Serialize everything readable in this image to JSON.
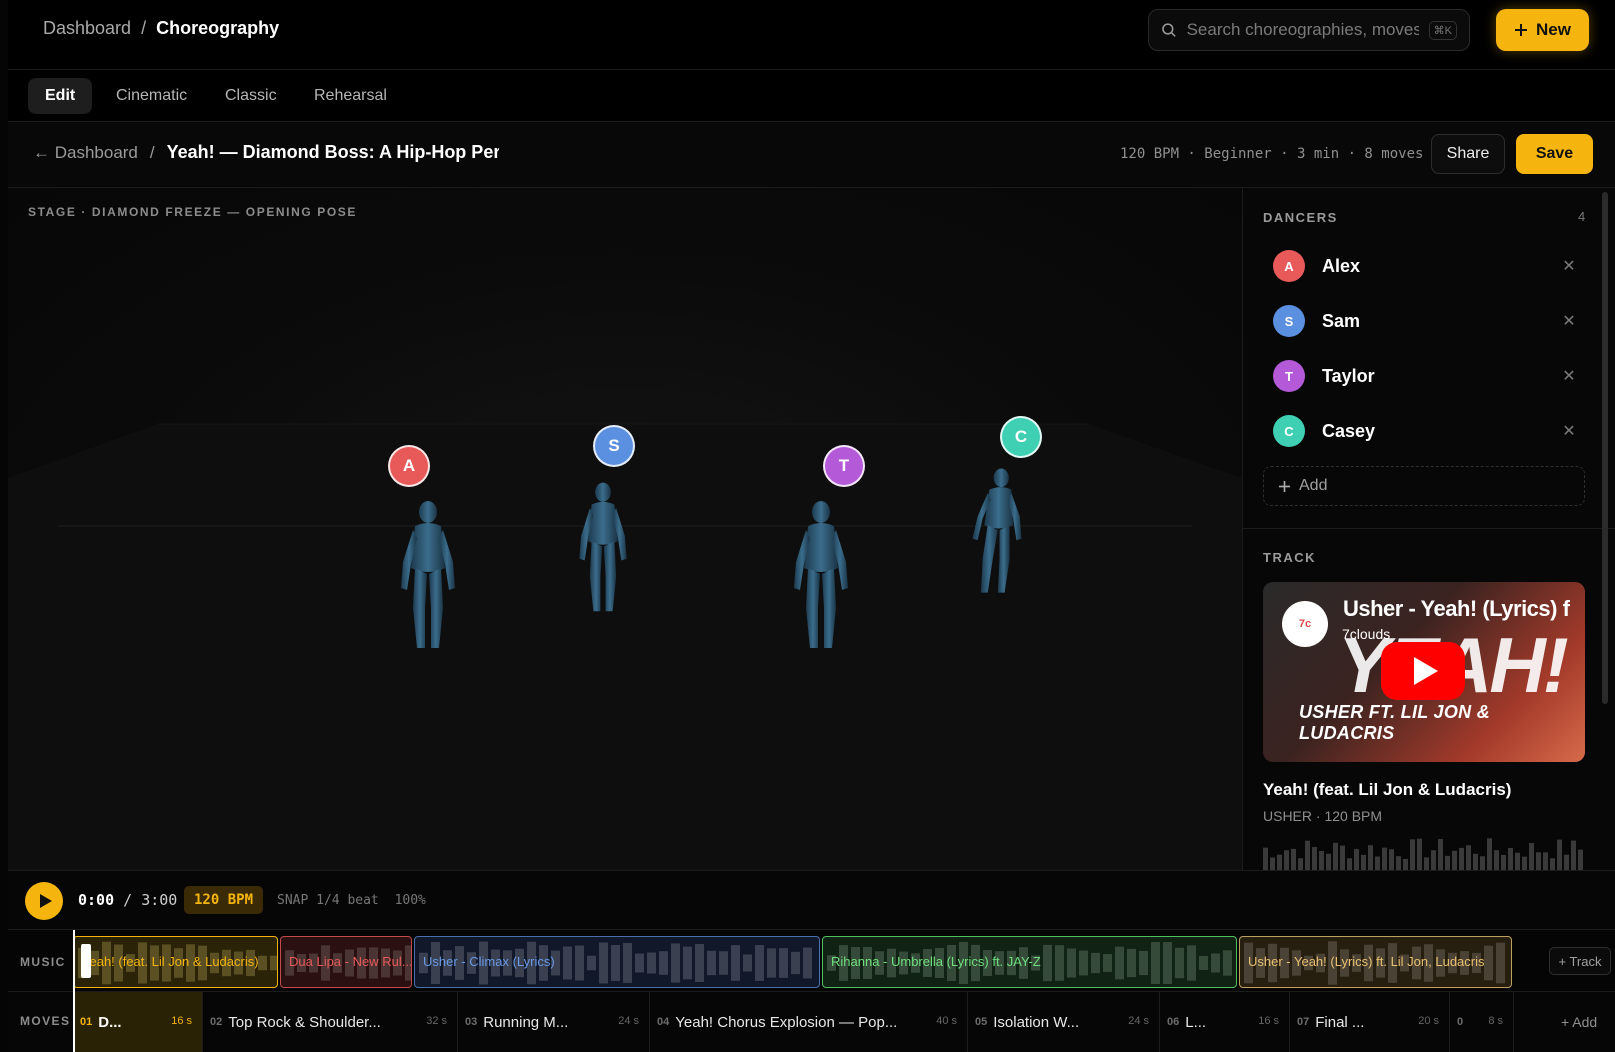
{
  "topbar": {
    "breadcrumb_root": "Dashboard",
    "breadcrumb_sep": "/",
    "breadcrumb_current": "Choreography",
    "search_placeholder": "Search choreographies, moves",
    "search_shortcut": "⌘K",
    "new_label": "New"
  },
  "tabs": [
    {
      "label": "Edit",
      "active": true
    },
    {
      "label": "Cinematic",
      "active": false
    },
    {
      "label": "Classic",
      "active": false
    },
    {
      "label": "Rehearsal",
      "active": false
    }
  ],
  "project": {
    "back_label": "← Dashboard",
    "sep": "/",
    "title": "Yeah! — Diamond Boss: A Hip-Hop Perf",
    "meta": "120 BPM · Beginner · 3 min · 8 moves",
    "share_label": "Share",
    "save_label": "Save"
  },
  "stage": {
    "label": "STAGE · DIAMOND FREEZE — OPENING POSE",
    "badges": [
      "A",
      "S",
      "T",
      "C"
    ]
  },
  "dancers": {
    "title": "DANCERS",
    "count": "4",
    "items": [
      {
        "initial": "A",
        "name": "Alex",
        "color": "#e85a5a"
      },
      {
        "initial": "S",
        "name": "Sam",
        "color": "#5b8fe0"
      },
      {
        "initial": "T",
        "name": "Taylor",
        "color": "#b45ad8"
      },
      {
        "initial": "C",
        "name": "Casey",
        "color": "#3fd0b4"
      }
    ],
    "add_label": "Add"
  },
  "track": {
    "title": "TRACK",
    "video_title": "Usher - Yeah! (Lyrics) f",
    "video_channel": "7clouds",
    "video_big": "YEAH!",
    "video_sub": "USHER FT. LIL JON & LUDACRIS",
    "song": "Yeah! (feat. Lil Jon & Ludacris)",
    "artist_bpm": "USHER · 120 BPM"
  },
  "transport": {
    "current": "0:00",
    "sep": "/",
    "total": "3:00",
    "bpm": "120 BPM",
    "snap": "SNAP 1/4 beat",
    "zoom": "100%"
  },
  "music": {
    "label": "MUSIC",
    "add_label": "+ Track",
    "clips": [
      {
        "label": "Yeah! (feat. Lil Jon & Ludacris)",
        "color": "#f5b50e"
      },
      {
        "label": "Dua Lipa - New Rul...",
        "color": "#e85a5a"
      },
      {
        "label": "Usher - Climax (Lyrics)",
        "color": "#5b8fe0"
      },
      {
        "label": "Rihanna - Umbrella (Lyrics) ft. JAY-Z",
        "color": "#5fd070"
      },
      {
        "label": "Usher - Yeah! (Lyrics) ft. Lil Jon, Ludacris",
        "color": "#e8c070"
      }
    ]
  },
  "moves": {
    "label": "MOVES",
    "add_label": "+ Add",
    "items": [
      {
        "num": "01",
        "name": "D...",
        "dur": "16 s"
      },
      {
        "num": "02",
        "name": "Top Rock & Shoulder...",
        "dur": "32 s"
      },
      {
        "num": "03",
        "name": "Running M...",
        "dur": "24 s"
      },
      {
        "num": "04",
        "name": "Yeah! Chorus Explosion — Pop...",
        "dur": "40 s"
      },
      {
        "num": "05",
        "name": "Isolation W...",
        "dur": "24 s"
      },
      {
        "num": "06",
        "name": "L...",
        "dur": "16 s"
      },
      {
        "num": "07",
        "name": "Final ...",
        "dur": "20 s"
      },
      {
        "num": "0",
        "name": "",
        "dur": "8 s"
      }
    ]
  }
}
